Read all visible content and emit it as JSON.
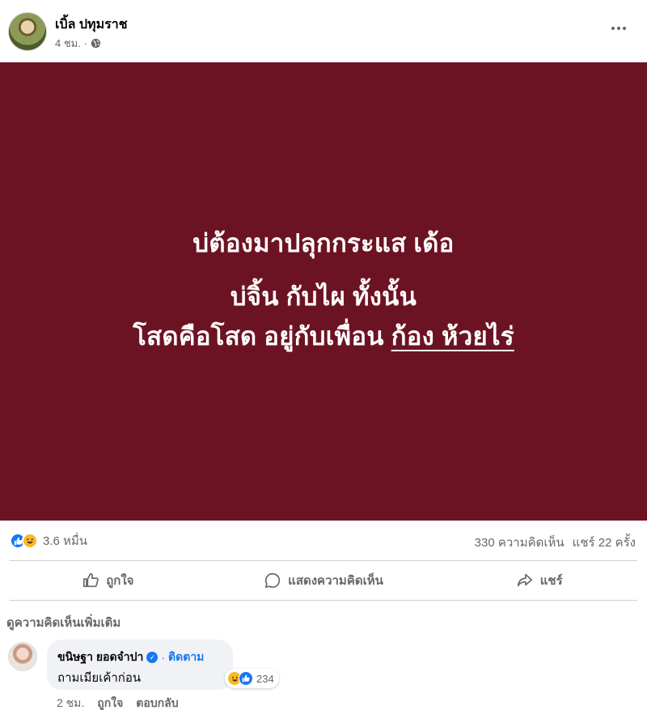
{
  "post": {
    "author": "เบิ้ล ปทุมราช",
    "time": "4 ชม. ·",
    "image_text": {
      "line1": "บ่ต้องมาปลุกกระแส เด้อ",
      "line2": "บ่จิ้น กับไผ ทั้งนั้น",
      "line3_prefix": "โสดคือโสด อยู่กับเพื่อน ",
      "line3_underlined": "ก้อง ห้วยไร่"
    },
    "background_color": "#6c1323"
  },
  "stats": {
    "reactions_count": "3.6 หมื่น",
    "comments": "330 ความคิดเห็น",
    "shares": "แชร์ 22 ครั้ง"
  },
  "actions": {
    "like": "ถูกใจ",
    "comment": "แสดงความคิดเห็น",
    "share": "แชร์"
  },
  "view_more_comments": "ดูความคิดเห็นเพิ่มเติม",
  "comment": {
    "author": "ขนิษฐา ยอดจำปา",
    "separator": "·",
    "follow": "ติดตาม",
    "text": "ถามเมียเค้าก่อน",
    "reaction_count": "234",
    "time": "2 ชม.",
    "like": "ถูกใจ",
    "reply": "ตอบกลับ"
  },
  "colors": {
    "accent": "#1877f2",
    "secondary_text": "#65676b"
  },
  "icons": [
    "more-options-icon",
    "globe-icon",
    "like-icon",
    "haha-icon",
    "comment-icon",
    "share-icon",
    "verified-icon"
  ]
}
